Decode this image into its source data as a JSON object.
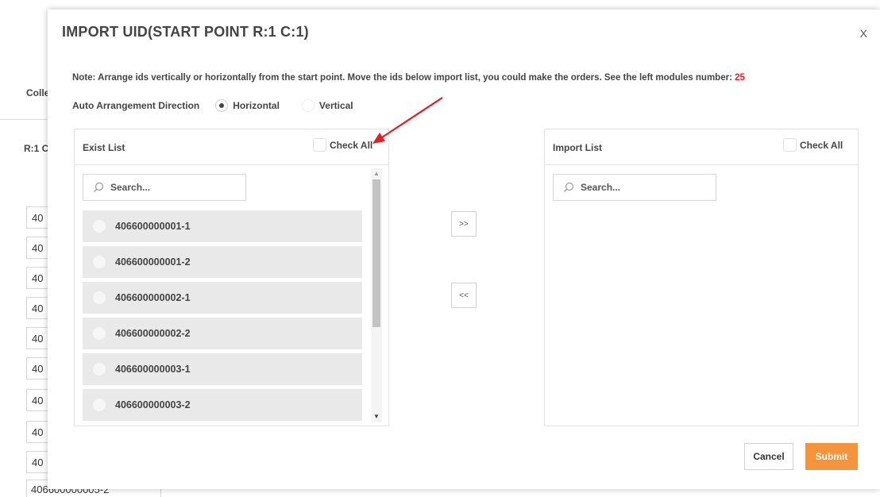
{
  "background": {
    "label_1": "Colle",
    "label_2": "R:1 C",
    "cells": [
      "40",
      "40",
      "40",
      "40",
      "40",
      "40",
      "40",
      "40",
      "40"
    ],
    "bottom_cell": "406600000005-2"
  },
  "modal": {
    "title": "IMPORT UID(START POINT R:1 C:1)",
    "close_label": "X",
    "note_text": "Note: Arrange ids vertically or horizontally from the start point. Move the ids below import list, you could make the orders. See the left modules number: ",
    "note_number": "25",
    "direction_label": "Auto Arrangement Direction",
    "direction_options": [
      {
        "label": "Horizontal",
        "selected": true
      },
      {
        "label": "Vertical",
        "selected": false
      }
    ]
  },
  "exist_list": {
    "title": "Exist List",
    "check_all_label": "Check All",
    "search_placeholder": "Search...",
    "items": [
      "406600000001-1",
      "406600000001-2",
      "406600000002-1",
      "406600000002-2",
      "406600000003-1",
      "406600000003-2"
    ]
  },
  "import_list": {
    "title": "Import List",
    "check_all_label": "Check All",
    "search_placeholder": "Search...",
    "items": []
  },
  "transfer": {
    "move_right_label": ">>",
    "move_left_label": "<<"
  },
  "footer": {
    "cancel_label": "Cancel",
    "submit_label": "Submit"
  },
  "colors": {
    "accent": "#f6943c",
    "note_number": "#e31f26",
    "annotation_arrow": "#e31f26"
  }
}
